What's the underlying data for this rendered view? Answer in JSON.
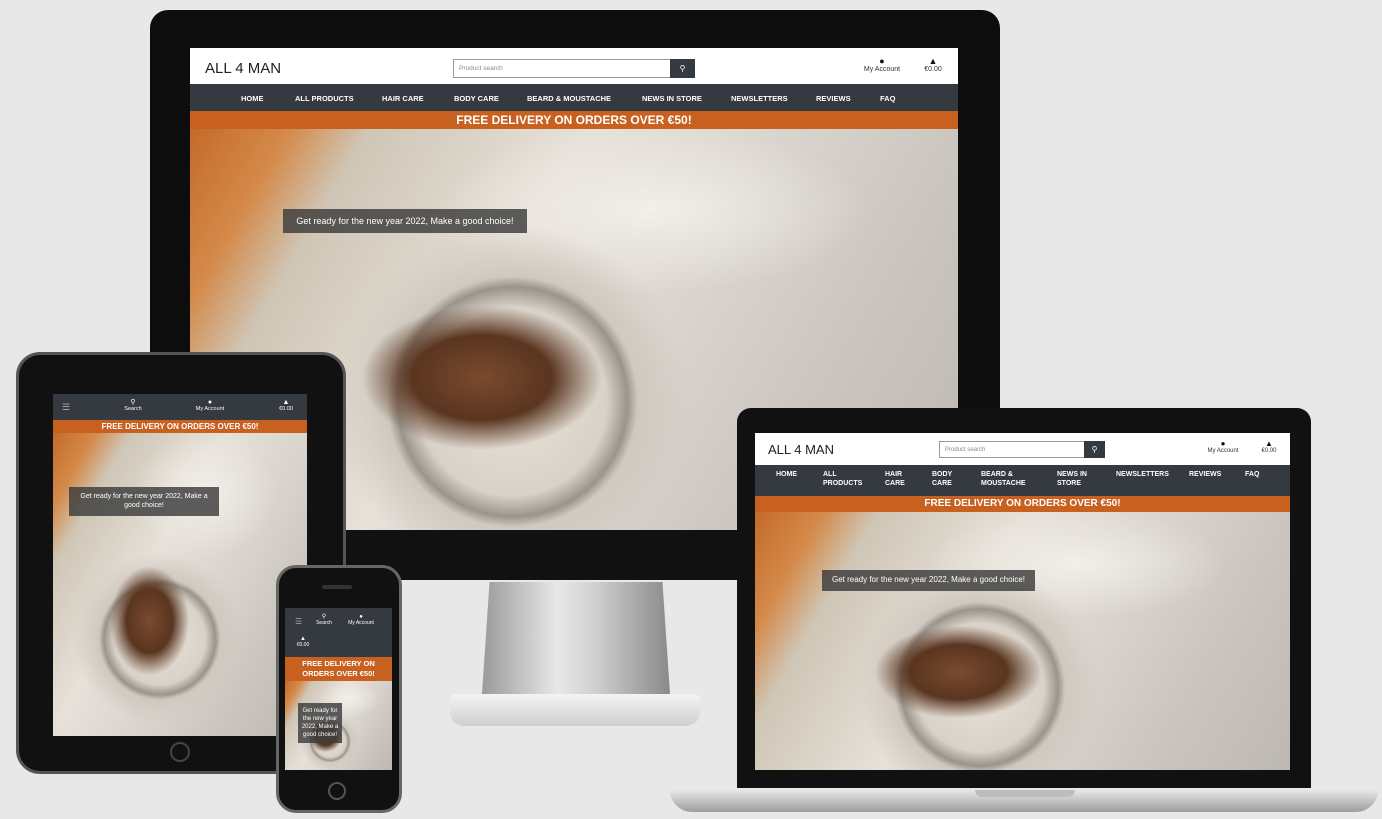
{
  "site": {
    "logo": "ALL 4 MAN",
    "search_placeholder": "Product search",
    "account_label": "My Account",
    "cart_total": "€0.00",
    "search_label": "Search",
    "banner": "FREE DELIVERY ON ORDERS OVER €50!",
    "hero_tagline": "Get ready for the new year 2022, Make a good choice!",
    "nav": [
      "HOME",
      "ALL PRODUCTS",
      "HAIR CARE",
      "BODY CARE",
      "BEARD & MOUSTACHE",
      "NEWS IN STORE",
      "NEWSLETTERS",
      "REVIEWS",
      "FAQ"
    ],
    "nav_wrapped": [
      "HOME",
      "ALL\nPRODUCTS",
      "HAIR\nCARE",
      "BODY\nCARE",
      "BEARD &\nMOUSTACHE",
      "NEWS IN\nSTORE",
      "NEWSLETTERS",
      "REVIEWS",
      "FAQ"
    ],
    "banner_phone": "FREE DELIVERY ON ORDERS OVER €50!",
    "hero_tagline_phone": "Get ready for the new year 2022, Make a good choice!"
  },
  "icons": {
    "search": "search-icon",
    "account": "user-icon",
    "cart": "shopping-bag-icon",
    "menu": "hamburger-menu-icon"
  },
  "colors": {
    "navbar": "#343a40",
    "banner": "#c8601f",
    "background": "#e8e8e8"
  }
}
